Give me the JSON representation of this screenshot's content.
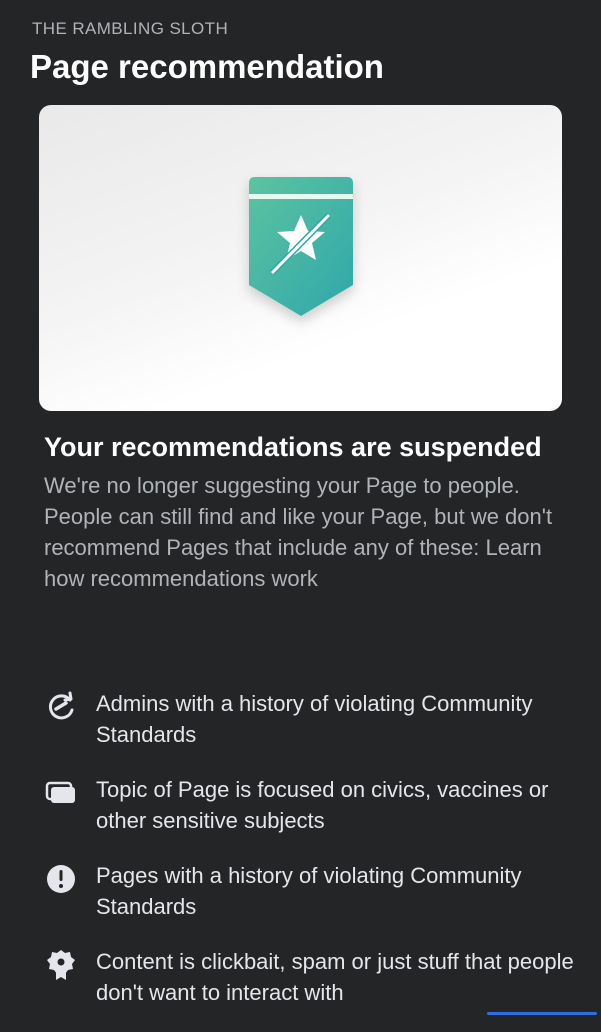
{
  "header": {
    "page_name": "THE RAMBLING SLOTH",
    "title": "Page recommendation"
  },
  "hero": {
    "icon": "recommendation-badge-slashed-star-icon",
    "badge_colors": [
      "#5cc3a0",
      "#2fa7ab"
    ]
  },
  "status": {
    "headline": "Your recommendations are suspended",
    "description": "We're no longer suggesting your Page to people. People can still find and like your Page, but we don't recommend Pages that include any of these: Learn how recommendations work"
  },
  "reasons": [
    {
      "icon": "history-arrow-icon",
      "text": "Admins with a history of violating Community Standards"
    },
    {
      "icon": "stacked-cards-icon",
      "text": "Topic of Page is focused on civics, vaccines or other sensitive subjects"
    },
    {
      "icon": "exclamation-circle-icon",
      "text": "Pages with a history of violating Community Standards"
    },
    {
      "icon": "badge-ribbon-icon",
      "text": "Content is clickbait, spam or just stuff that people don't want to interact with"
    }
  ],
  "colors": {
    "background": "#242526",
    "primary_text": "#e4e6eb",
    "secondary_text": "#b0b3b8",
    "accent": "#2d6fe3"
  }
}
